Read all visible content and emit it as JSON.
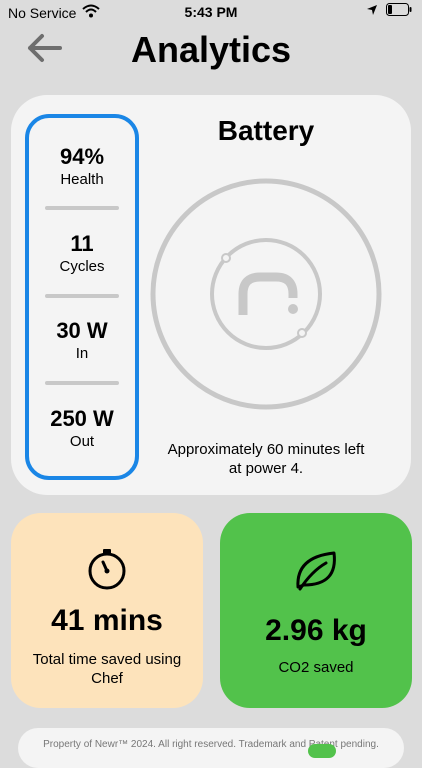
{
  "status_bar": {
    "carrier": "No Service",
    "time": "5:43 PM",
    "icons": [
      "wifi-icon",
      "location-arrow-icon",
      "battery-icon"
    ]
  },
  "header": {
    "title": "Analytics",
    "back_icon": "back-arrow-icon"
  },
  "battery_card": {
    "title": "Battery",
    "stats": [
      {
        "value": "94%",
        "label": "Health"
      },
      {
        "value": "11",
        "label": "Cycles"
      },
      {
        "value": "30 W",
        "label": "In"
      },
      {
        "value": "250 W",
        "label": "Out"
      }
    ],
    "note_line1": "Approximately 60 minutes left",
    "note_line2": "at power 4.",
    "accent": "#1a86e6"
  },
  "time_card": {
    "icon": "stopwatch-icon",
    "value": "41 mins",
    "label_line1": "Total time saved using",
    "label_line2": "Chef",
    "color": "#fde3bb"
  },
  "co2_card": {
    "icon": "leaf-icon",
    "value": "2.96 kg",
    "label": "CO2 saved",
    "color": "#52c24b"
  },
  "footer": {
    "text": "Property of Newr™ 2024. All right reserved. Trademark and Patent pending."
  }
}
